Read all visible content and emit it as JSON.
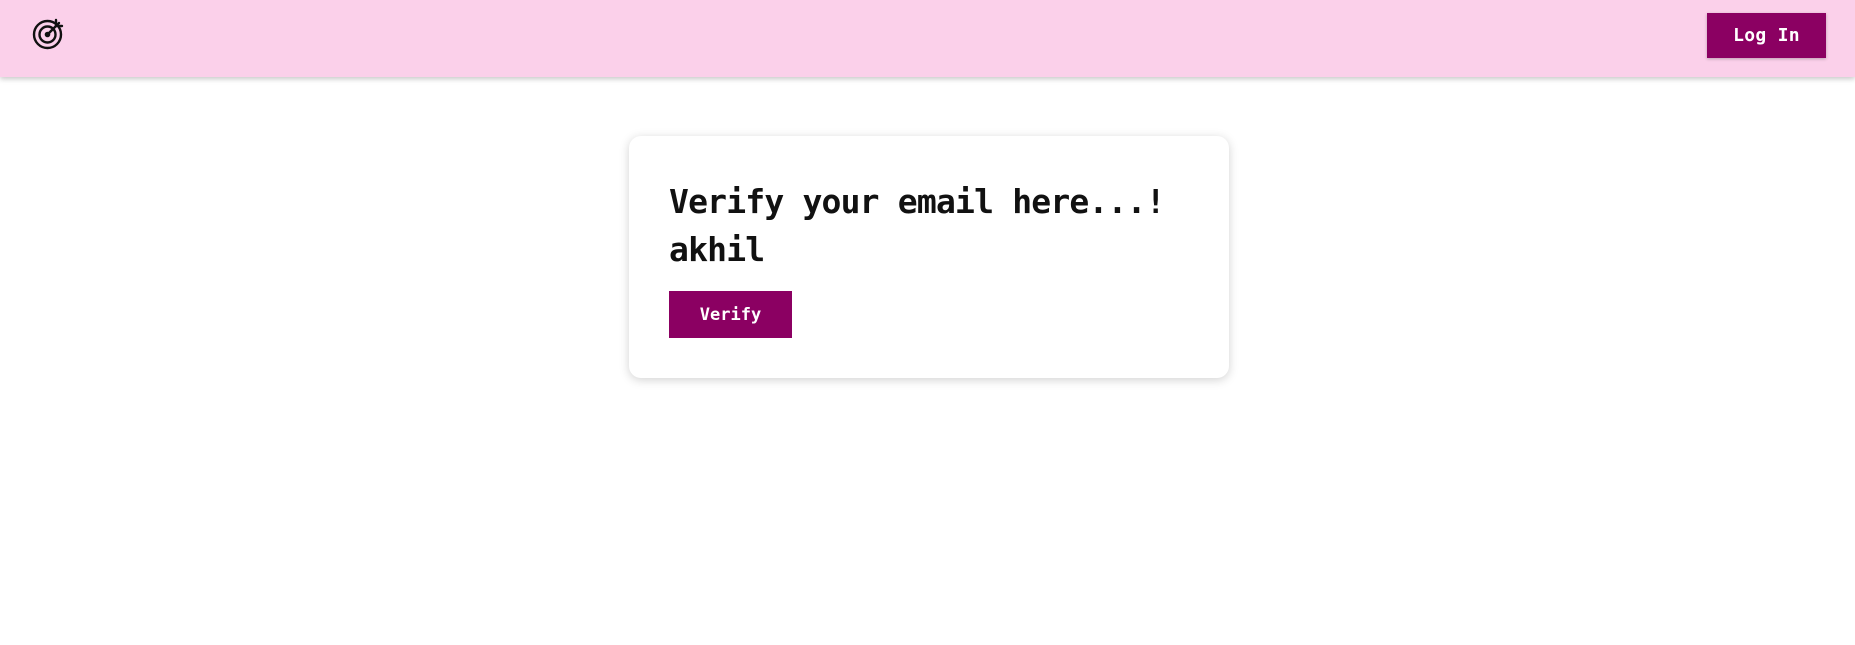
{
  "navbar": {
    "logo_icon": "target-arrow-icon",
    "login_label": "Log In",
    "background_color": "#fbd0ea",
    "accent_color": "#8b0062"
  },
  "card": {
    "title_line1": "Verify your email here...!",
    "title_line2": "akhil",
    "verify_label": "Verify"
  }
}
